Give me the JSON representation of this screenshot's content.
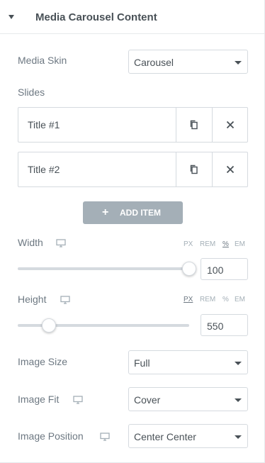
{
  "section": {
    "title": "Media Carousel Content"
  },
  "media_skin": {
    "label": "Media Skin",
    "value": "Carousel"
  },
  "slides": {
    "label": "Slides",
    "items": [
      {
        "title": "Title #1"
      },
      {
        "title": "Title #2"
      }
    ],
    "add_label": "ADD ITEM"
  },
  "width": {
    "label": "Width",
    "units": [
      "PX",
      "REM",
      "%",
      "EM"
    ],
    "active_unit": "%",
    "value": "100",
    "slider_fraction": 1.0
  },
  "height": {
    "label": "Height",
    "units": [
      "PX",
      "REM",
      "%",
      "EM"
    ],
    "active_unit": "PX",
    "value": "550",
    "slider_fraction": 0.18
  },
  "image_size": {
    "label": "Image Size",
    "value": "Full"
  },
  "image_fit": {
    "label": "Image Fit",
    "value": "Cover"
  },
  "image_position": {
    "label": "Image Position",
    "value": "Center Center"
  },
  "icons": {
    "caret": "caret-down-icon",
    "duplicate": "copy-icon",
    "remove": "close-icon",
    "add": "plus-icon",
    "responsive": "monitor-icon",
    "dropdown": "chevron-down-icon"
  },
  "colors": {
    "label": "#6d7882",
    "text": "#495157",
    "border": "#d5dadf",
    "button": "#a4afb7"
  }
}
